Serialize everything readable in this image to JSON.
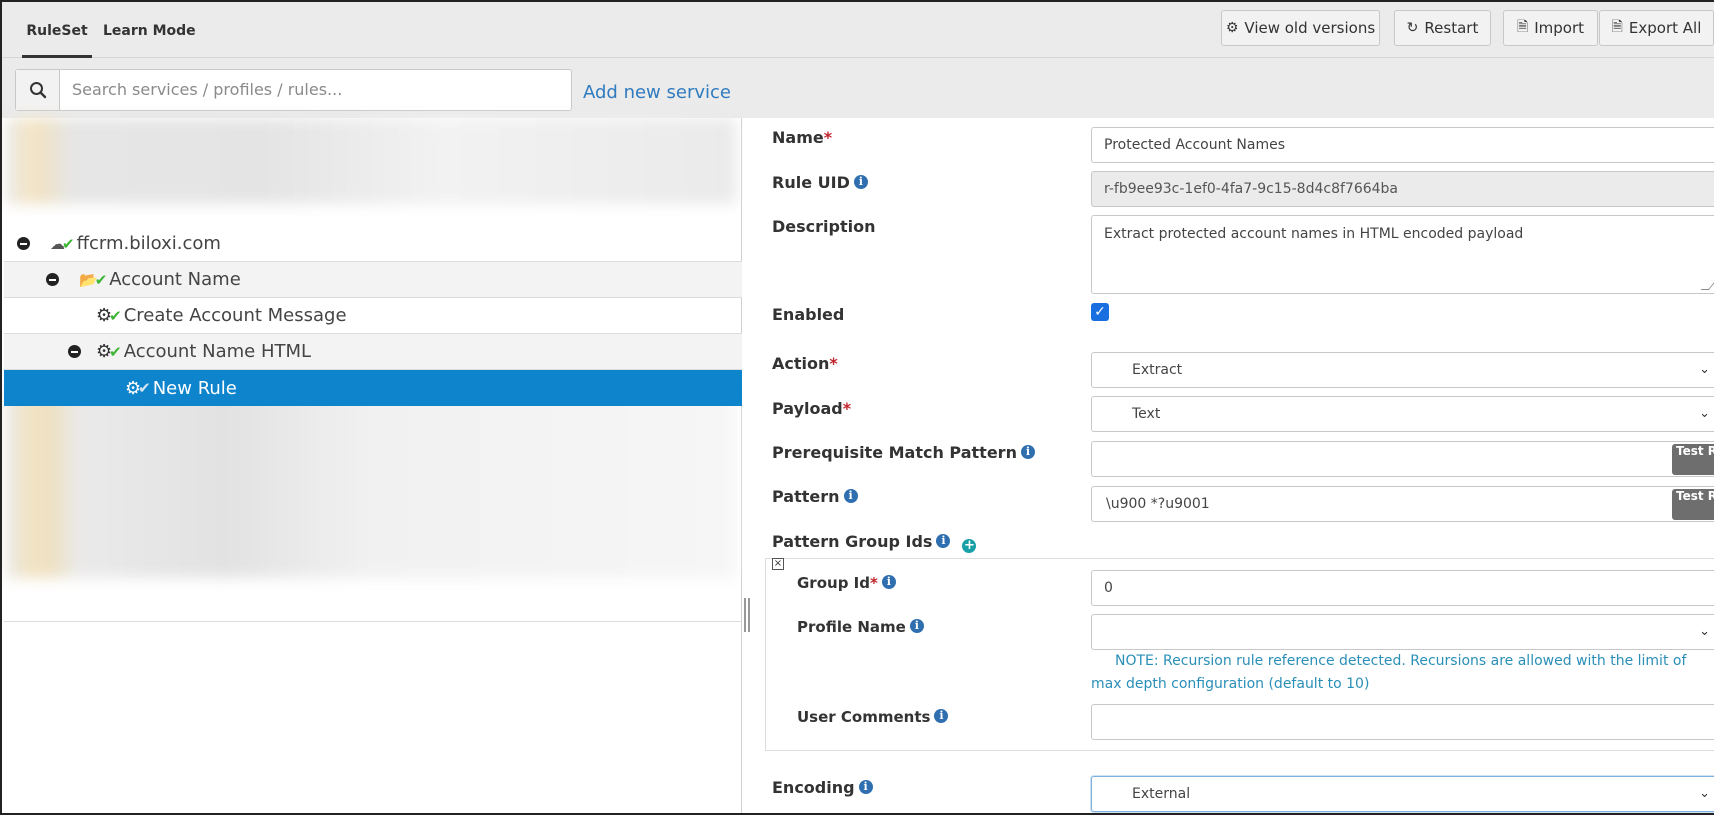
{
  "tabs": [
    {
      "label": "RuleSet",
      "active": true
    },
    {
      "label": "Learn Mode",
      "active": false
    }
  ],
  "toolbar": {
    "view_old": "View old versions",
    "restart": "Restart",
    "import": "Import",
    "export_all": "Export All"
  },
  "search": {
    "placeholder": "Search services / profiles / rules...",
    "value": ""
  },
  "add_service": "Add new service",
  "tree": {
    "service": "ffcrm.biloxi.com",
    "profile": "Account Name",
    "rule_create": "Create Account Message",
    "rule_html": "Account Name HTML",
    "rule_new": "New Rule"
  },
  "form": {
    "name_label": "Name",
    "name_value": "Protected Account Names",
    "uid_label": "Rule UID",
    "uid_value": "r-fb9ee93c-1ef0-4fa7-9c15-8d4c8f7664ba",
    "desc_label": "Description",
    "desc_value": "Extract protected account names in HTML encoded payload",
    "enabled_label": "Enabled",
    "enabled": true,
    "action_label": "Action",
    "action_value": "Extract",
    "payload_label": "Payload",
    "payload_value": "Text",
    "prereq_label": "Prerequisite Match Pattern",
    "prereq_value": "",
    "pattern_label": "Pattern",
    "pattern_value": "\\u900 *?u9001",
    "test_regex": "Test Regex",
    "group_ids_label": "Pattern Group Ids",
    "group_id_label": "Group Id",
    "group_id_value": "0",
    "profile_name_label": "Profile Name",
    "profile_name_value": "",
    "note": "NOTE: Recursion rule reference detected. Recursions are allowed with the limit of max depth configuration (default to 10)",
    "user_comments_label": "User Comments",
    "user_comments_value": "",
    "encoding_label": "Encoding",
    "encoding_value": "External"
  },
  "colors": {
    "selected_row": "#0e84cc",
    "link": "#2f7bbf",
    "required": "#c0242c",
    "check": "#3cb534",
    "note": "#2a8fb8"
  }
}
